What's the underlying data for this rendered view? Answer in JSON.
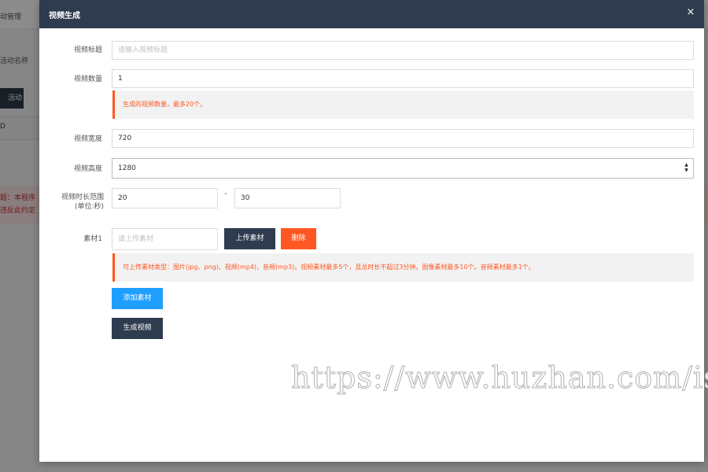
{
  "background": {
    "nav_fragment": "动管理",
    "label_fragment": "活动名称",
    "button_fragment": "活动",
    "column_fragment": "D",
    "alert_fragment_line1": "题：本程序",
    "alert_fragment_line2": "违反此约定"
  },
  "modal": {
    "title": "视频生成",
    "close_symbol": "×",
    "fields": {
      "video_title": {
        "label": "视频标题",
        "value": "",
        "placeholder": "请输入视频标题"
      },
      "video_count": {
        "label": "视频数量",
        "value": "1",
        "hint": "生成的视频数量，最多20个。"
      },
      "video_width": {
        "label": "视频宽度",
        "value": "720"
      },
      "video_height": {
        "label": "视频高度",
        "value": "1280",
        "arrow": "▲▼"
      },
      "duration_range": {
        "label": "视频时长范围(单位:秒)",
        "min": "20",
        "separator": "-",
        "max": "30"
      },
      "material_1": {
        "label": "素材1",
        "value": "",
        "placeholder": "请上传素材",
        "upload_label": "上传素材",
        "delete_label": "删除",
        "hint": "可上传素材类型：图片(jpg、png)、视频(mp4)、音频(mp3)。视频素材最多5个，且总时长不超过3分钟。图像素材最多10个。音频素材最多1个。"
      }
    },
    "add_material_label": "添加素材",
    "generate_label": "生成视频"
  },
  "watermark": "https://www.huzhan.com/ish",
  "colors": {
    "header": "#2f3b4f",
    "accent_orange": "#ff5722",
    "accent_blue": "#1e9fff"
  }
}
